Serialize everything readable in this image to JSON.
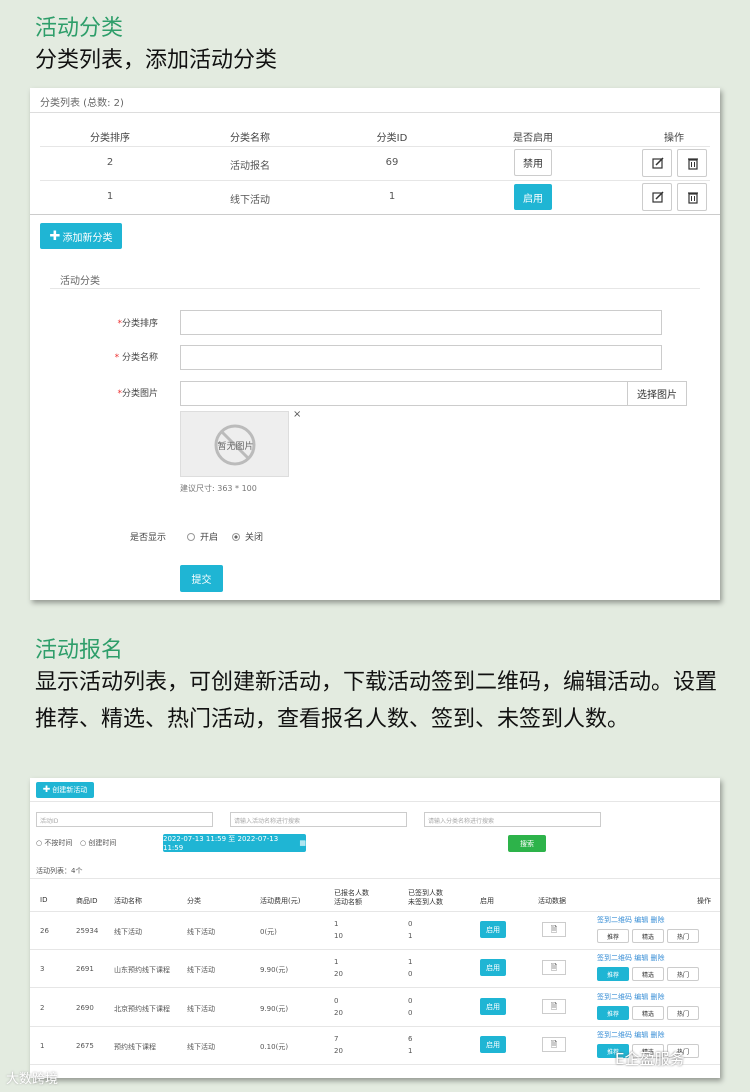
{
  "section1": {
    "title": "活动分类",
    "desc": "分类列表，添加活动分类"
  },
  "panel1": {
    "header": "分类列表 (总数: 2)",
    "cols": [
      "分类排序",
      "分类名称",
      "分类ID",
      "是否启用",
      "操作"
    ],
    "rows": [
      {
        "order": "2",
        "name": "活动报名",
        "id": "69",
        "toggle": "禁用"
      },
      {
        "order": "1",
        "name": "线下活动",
        "id": "1",
        "toggle": "启用"
      }
    ],
    "add_button": "添加新分类",
    "form_title": "活动分类",
    "labels": {
      "order": "分类排序",
      "name": "分类名称",
      "image": "分类图片",
      "display": "是否显示"
    },
    "choose_image": "选择图片",
    "no_image": "暂无图片",
    "size_hint": "建议尺寸: 363 * 100",
    "radio_on": "开启",
    "radio_off": "关闭",
    "submit": "提交"
  },
  "section2": {
    "title": "活动报名",
    "desc": "显示活动列表，可创建新活动，下载活动签到二维码，编辑活动。设置推荐、精选、热门活动，查看报名人数、签到、未签到人数。"
  },
  "panel2": {
    "create_button": "创建新活动",
    "ph_id": "活动ID",
    "ph_name": "请输入活动名称进行搜索",
    "ph_cat": "请输入分类名称进行搜索",
    "radio1": "不按时间",
    "radio2": "创建时间",
    "date_range": "2022-07-13 11:59 至 2022-07-13 11:59",
    "search": "搜索",
    "list_count": "活动列表：4个",
    "cols": [
      "ID",
      "商品ID",
      "活动名称",
      "分类",
      "活动费用(元)",
      "已报名人数\n活动名额",
      "已签到人数\n未签到人数",
      "启用",
      "活动数据",
      "操作"
    ],
    "rows": [
      {
        "id": "26",
        "gid": "25934",
        "name": "线下活动",
        "cat": "线下活动",
        "fee": "0(元)",
        "signed": "1",
        "quota": "10",
        "checked": "0",
        "unchecked": "1"
      },
      {
        "id": "3",
        "gid": "2691",
        "name": "山东预约线下课程",
        "cat": "线下活动",
        "fee": "9.90(元)",
        "signed": "1",
        "quota": "20",
        "checked": "1",
        "unchecked": "0"
      },
      {
        "id": "2",
        "gid": "2690",
        "name": "北京预约线下课程",
        "cat": "线下活动",
        "fee": "9.90(元)",
        "signed": "0",
        "quota": "20",
        "checked": "0",
        "unchecked": "0"
      },
      {
        "id": "1",
        "gid": "2675",
        "name": "预约线下课程",
        "cat": "线下活动",
        "fee": "0.10(元)",
        "signed": "7",
        "quota": "20",
        "checked": "6",
        "unchecked": "1"
      }
    ],
    "enable": "启用",
    "ops_links": "签到二维码 编辑 删除",
    "ops_btns": [
      "推荐",
      "精选",
      "热门"
    ]
  },
  "watermark_left": "大数跨境",
  "watermark_right": "E企盈服务"
}
